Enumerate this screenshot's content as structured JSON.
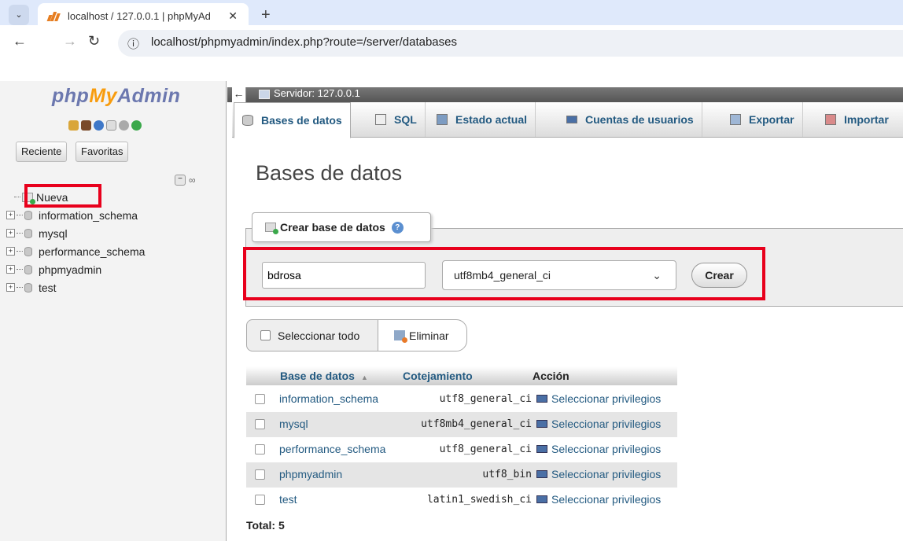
{
  "browser": {
    "tab_title": "localhost / 127.0.0.1 | phpMyAd",
    "url": "localhost/phpmyadmin/index.php?route=/server/databases"
  },
  "sidebar": {
    "logo_php": "php",
    "logo_my": "My",
    "logo_admin": "Admin",
    "recent_label": "Reciente",
    "favorites_label": "Favoritas",
    "tree": [
      {
        "label": "Nueva"
      },
      {
        "label": "information_schema"
      },
      {
        "label": "mysql"
      },
      {
        "label": "performance_schema"
      },
      {
        "label": "phpmyadmin"
      },
      {
        "label": "test"
      }
    ]
  },
  "server": {
    "label": "Servidor: 127.0.0.1"
  },
  "topmenu": [
    {
      "label": "Bases de datos",
      "icon": "database-icon"
    },
    {
      "label": "SQL",
      "icon": "sql-icon"
    },
    {
      "label": "Estado actual",
      "icon": "status-icon"
    },
    {
      "label": "Cuentas de usuarios",
      "icon": "users-icon"
    },
    {
      "label": "Exportar",
      "icon": "export-icon"
    },
    {
      "label": "Importar",
      "icon": "import-icon"
    }
  ],
  "page_title": "Bases de datos",
  "create": {
    "legend": "Crear base de datos",
    "db_name_value": "bdrosa",
    "collation_selected": "utf8mb4_general_ci",
    "create_button": "Crear"
  },
  "bulk": {
    "select_all": "Seleccionar todo",
    "delete": "Eliminar"
  },
  "table": {
    "headers": [
      "Base de datos",
      "Cotejamiento",
      "Acción"
    ],
    "rows": [
      {
        "name": "information_schema",
        "collation": "utf8_general_ci",
        "action": "Seleccionar privilegios"
      },
      {
        "name": "mysql",
        "collation": "utf8mb4_general_ci",
        "action": "Seleccionar privilegios"
      },
      {
        "name": "performance_schema",
        "collation": "utf8_general_ci",
        "action": "Seleccionar privilegios"
      },
      {
        "name": "phpmyadmin",
        "collation": "utf8_bin",
        "action": "Seleccionar privilegios"
      },
      {
        "name": "test",
        "collation": "latin1_swedish_ci",
        "action": "Seleccionar privilegios"
      }
    ],
    "total": "Total: 5"
  },
  "colors": {
    "link": "#235a81",
    "highlight_box": "#e8001c"
  }
}
